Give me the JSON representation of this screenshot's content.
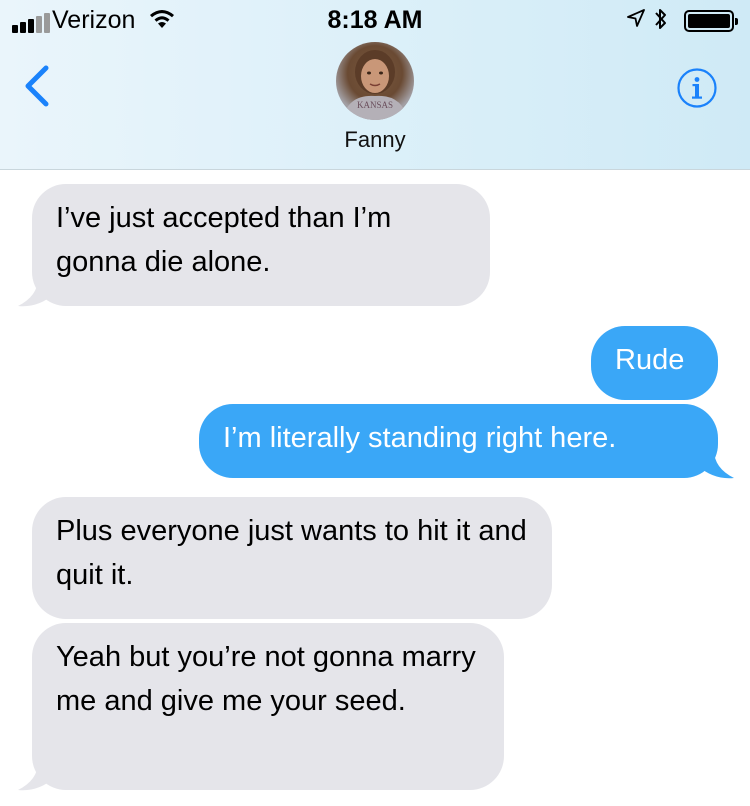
{
  "status_bar": {
    "carrier": "Verizon",
    "time": "8:18 AM"
  },
  "header": {
    "contact_name": "Fanny"
  },
  "messages": [
    {
      "side": "received",
      "text": "I’ve just accepted than I’m gonna die alone."
    },
    {
      "side": "sent",
      "text": "Rude"
    },
    {
      "side": "sent",
      "text": "I’m literally standing right here."
    },
    {
      "side": "received",
      "text": "Plus everyone just wants to hit it and quit it."
    },
    {
      "side": "received",
      "text": "Yeah but you’re not gonna marry me and give me your seed."
    }
  ],
  "colors": {
    "sent_bubble": "#3aa7f7",
    "received_bubble": "#e5e5ea",
    "ios_blue": "#1a82fb"
  },
  "icons": [
    "signal-icon",
    "wifi-icon",
    "location-arrow-icon",
    "bluetooth-icon",
    "battery-icon",
    "back-chevron-icon",
    "info-icon"
  ]
}
